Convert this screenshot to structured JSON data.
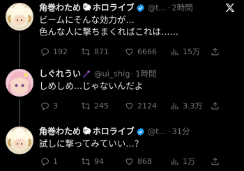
{
  "tweets": [
    {
      "name": "角巻わため",
      "badge_text": "ホロライブ",
      "handle": "@t...",
      "time": "2時間",
      "lines": [
        "ビームにそんな効力が…",
        "色んな人に撃ちまくればこれは……"
      ],
      "replies": "192",
      "retweets": "871",
      "likes": "6666",
      "views": "15万"
    },
    {
      "name": "しぐれうい",
      "handle": "@ui_shig",
      "time": "1時間",
      "lines": [
        "しめしめ...じゃないんだよ"
      ],
      "replies": "3",
      "retweets": "245",
      "likes": "2124",
      "views": "3.3万"
    },
    {
      "name": "角巻わため",
      "badge_text": "ホロライブ",
      "handle": "@t...",
      "time": "31分",
      "lines": [
        "試しに撃ってみていい…？"
      ],
      "replies": "1",
      "retweets": "94",
      "likes": "868",
      "views": "1万"
    }
  ],
  "separator": "·",
  "icons": {
    "platform": "x-logo-icon",
    "verified": "verified-check-icon",
    "reply": "reply-icon",
    "retweet": "retweet-icon",
    "like": "heart-icon",
    "views": "views-chart-icon",
    "share": "share-icon",
    "sheep": "sheep-emoji-icon",
    "umbrella": "umbrella-emoji-icon"
  },
  "colors": {
    "background": "#000000",
    "text": "#e7e9ea",
    "muted": "#71767b",
    "verified": "#1d9bf0"
  }
}
